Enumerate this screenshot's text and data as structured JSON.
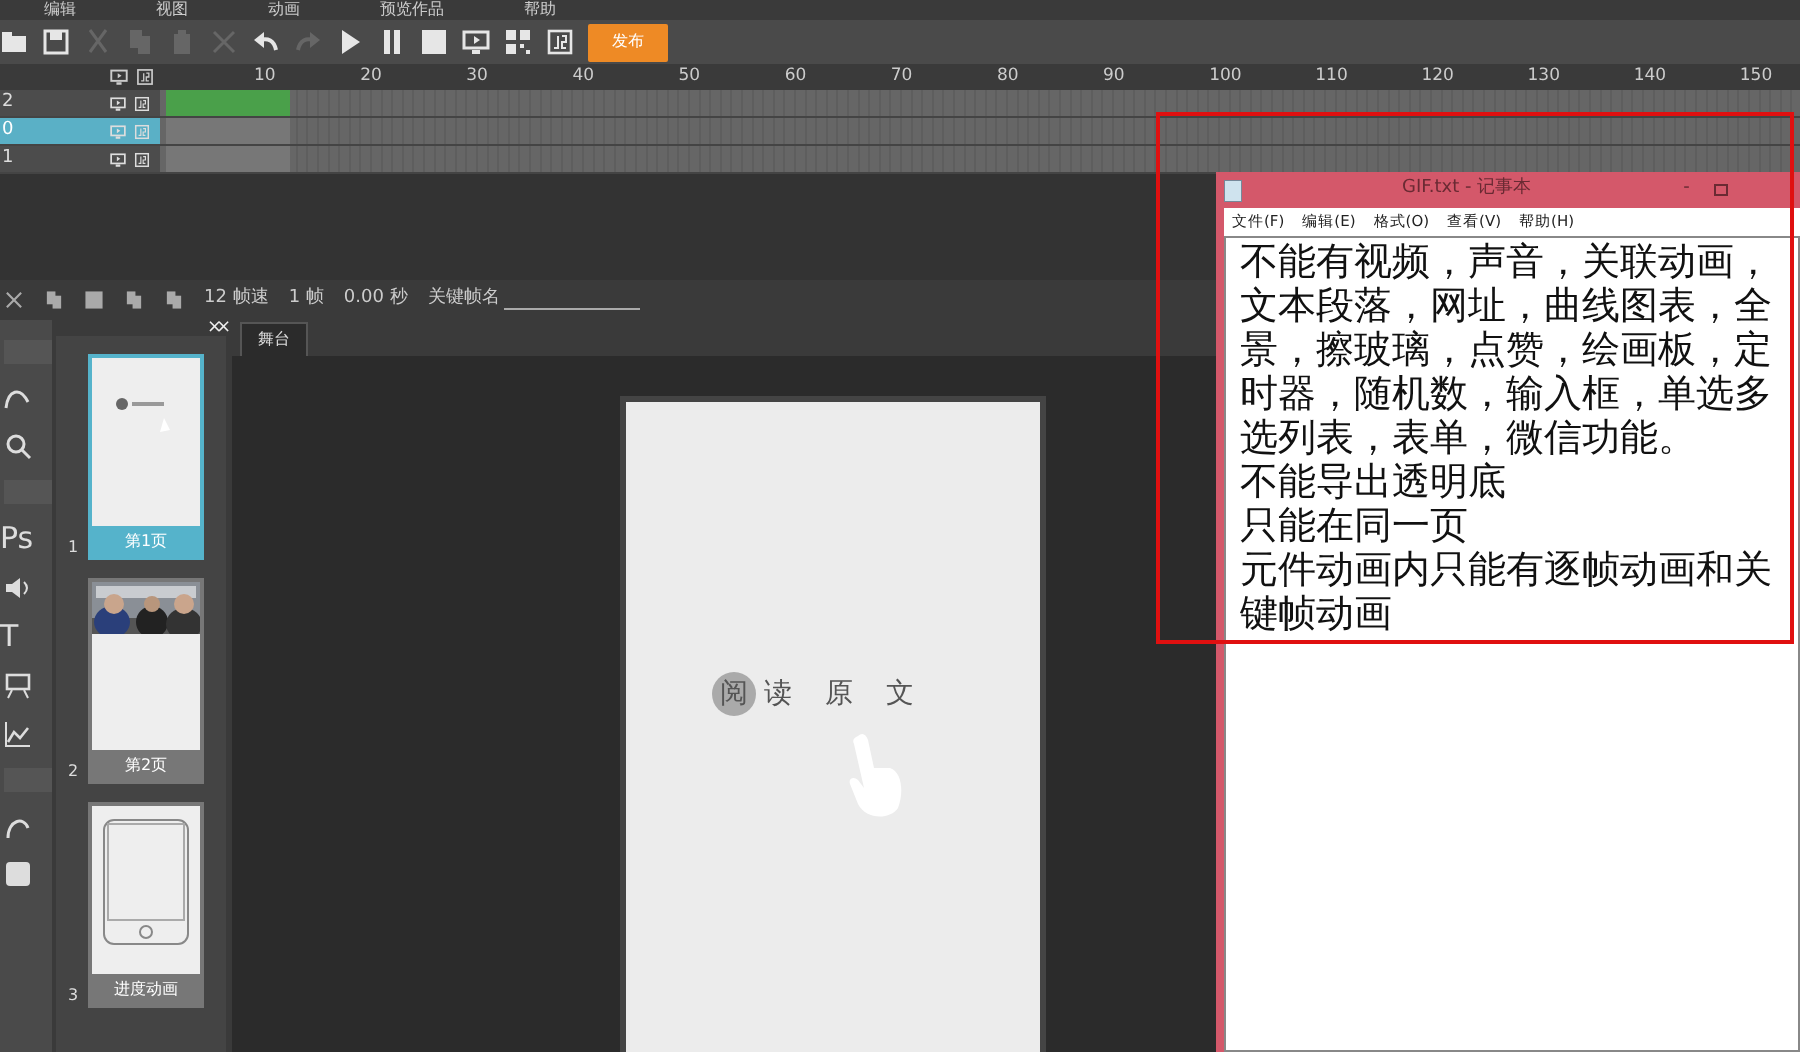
{
  "menu": [
    "编辑",
    "视图",
    "动画",
    "预览作品",
    "帮助"
  ],
  "toolbar": [
    {
      "kind": "new",
      "disabled": false
    },
    {
      "kind": "save",
      "disabled": false
    },
    {
      "kind": "cut",
      "disabled": true
    },
    {
      "kind": "copy",
      "disabled": true
    },
    {
      "kind": "paste",
      "disabled": true
    },
    {
      "kind": "delete",
      "disabled": true
    },
    {
      "kind": "undo",
      "disabled": false
    },
    {
      "kind": "redo",
      "disabled": true
    },
    {
      "kind": "play",
      "disabled": false
    },
    {
      "kind": "pause",
      "disabled": false
    },
    {
      "kind": "stop",
      "disabled": false
    },
    {
      "kind": "preview",
      "disabled": false
    },
    {
      "kind": "qr",
      "disabled": false
    },
    {
      "kind": "js",
      "disabled": false
    }
  ],
  "publish_button": "发布",
  "timeline": {
    "ruler": [
      "10",
      "20",
      "30",
      "40",
      "50",
      "60",
      "70",
      "80",
      "90",
      "100",
      "110",
      "120",
      "130",
      "140",
      "150"
    ],
    "layers": [
      {
        "name": "2",
        "selected": false,
        "tween": true
      },
      {
        "name": "0",
        "selected": true,
        "tween": false
      },
      {
        "name": "1",
        "selected": false,
        "tween": false
      }
    ]
  },
  "frame_bar": {
    "fps": "12 帧速",
    "frame": "1 帧",
    "time": "0.00 秒",
    "keyframe_label": "关键帧名"
  },
  "panel_close": [
    "×",
    "×"
  ],
  "left_tools": [
    {
      "kind": "pen"
    },
    {
      "kind": "search"
    },
    {
      "kind": "text",
      "label": "Ps"
    },
    {
      "kind": "sound"
    },
    {
      "kind": "text",
      "label": "T"
    },
    {
      "kind": "easel"
    },
    {
      "kind": "chart"
    },
    {
      "kind": "curve"
    },
    {
      "kind": "square"
    }
  ],
  "pages": [
    {
      "number": "1",
      "label": "第1页",
      "selected": true,
      "kind": "text"
    },
    {
      "number": "2",
      "label": "第2页",
      "selected": false
    },
    {
      "number": "3",
      "label": "进度动画",
      "selected": false,
      "kind": "phone"
    }
  ],
  "stage": {
    "tab": "舞台",
    "highlight_text": "阅",
    "text": "读 原 文"
  },
  "notepad": {
    "title": "GIF.txt - 记事本",
    "minimize": "-",
    "menu": [
      "文件(F)",
      "编辑(E)",
      "格式(O)",
      "查看(V)",
      "帮助(H)"
    ],
    "paragraphs": [
      "不能有视频，声音，关联动画，文本段落，网址，曲线图表，全景，擦玻璃，点赞，绘画板，定时器，随机数，输入框，单选多选列表，表单，微信功能。",
      "不能导出透明底",
      "只能在同一页",
      "元件动画内只能有逐帧动画和关键帧动画"
    ]
  }
}
